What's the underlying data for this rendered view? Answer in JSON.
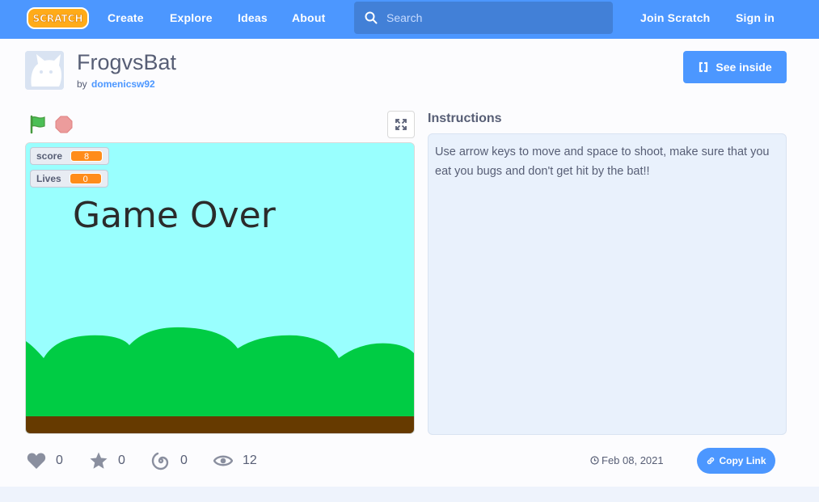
{
  "nav": {
    "logo_text": "SCRATCH",
    "links": [
      "Create",
      "Explore",
      "Ideas",
      "About"
    ],
    "search_placeholder": "Search",
    "join": "Join Scratch",
    "signin": "Sign in"
  },
  "project": {
    "title": "FrogvsBat",
    "by": "by",
    "author": "domenicsw92",
    "see_inside": "See inside"
  },
  "stage": {
    "monitors": [
      {
        "label": "score",
        "value": "8"
      },
      {
        "label": "Lives",
        "value": "0"
      }
    ],
    "game_text": "Game Over",
    "colors": {
      "sky": "#99fffe",
      "hills": "#00cc44",
      "ground": "#663a00"
    }
  },
  "instructions": {
    "label": "Instructions",
    "text": "Use arrow keys to move and space to shoot, make sure that you eat you bugs and don't get hit by the bat!!"
  },
  "stats": {
    "loves": "0",
    "favorites": "0",
    "remixes": "0",
    "views": "12",
    "date": "Feb 08, 2021",
    "copy_link": "Copy Link"
  },
  "colors": {
    "accent": "#4c97ff",
    "text": "#575e75"
  }
}
